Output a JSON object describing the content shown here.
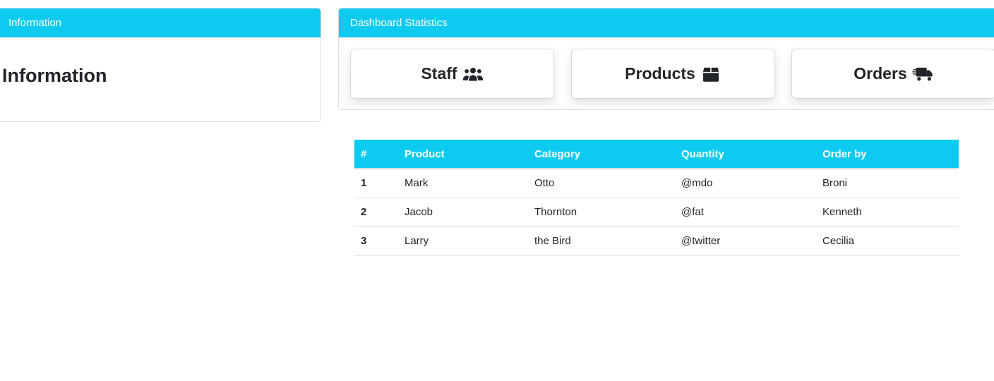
{
  "info_card": {
    "header": "Information",
    "title": "/ Information"
  },
  "stats_card": {
    "header": "Dashboard Statistics",
    "staff": {
      "label": "Staff",
      "icon": "users-icon"
    },
    "products": {
      "label": "Products",
      "icon": "box-icon"
    },
    "orders": {
      "label": "Orders",
      "icon": "shipping-truck-icon"
    }
  },
  "table": {
    "columns": [
      "#",
      "Product",
      "Category",
      "Quantity",
      "Order by"
    ],
    "rows": [
      [
        "1",
        "Mark",
        "Otto",
        "@mdo",
        "Broni"
      ],
      [
        "2",
        "Jacob",
        "Thornton",
        "@fat",
        "Kenneth"
      ],
      [
        "3",
        "Larry",
        "the Bird",
        "@twitter",
        "Cecilia"
      ]
    ]
  },
  "colors": {
    "accent": "#0dcaf0",
    "text": "#212529"
  }
}
